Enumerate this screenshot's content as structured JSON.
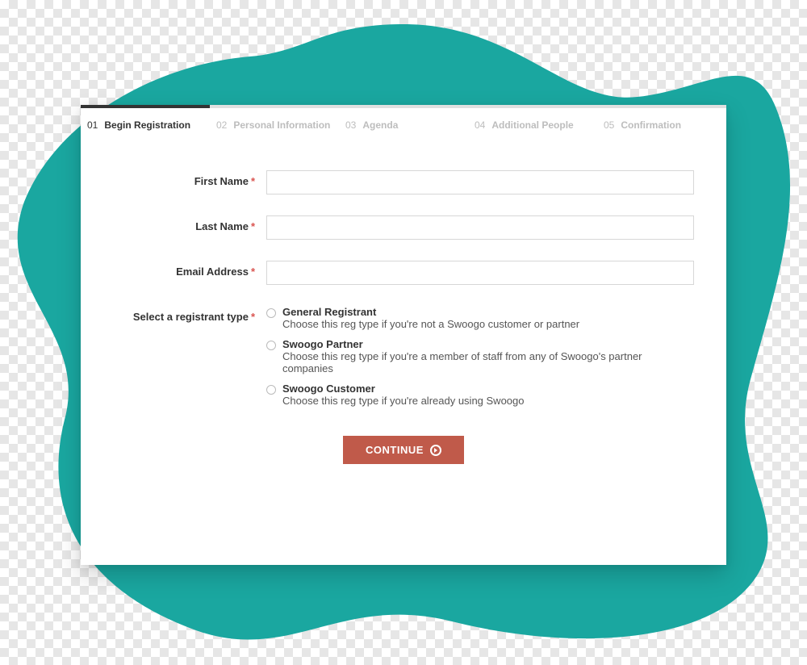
{
  "steps": [
    {
      "num": "01",
      "label": "Begin Registration",
      "active": true
    },
    {
      "num": "02",
      "label": "Personal Information",
      "active": false
    },
    {
      "num": "03",
      "label": "Agenda",
      "active": false
    },
    {
      "num": "04",
      "label": "Additional People",
      "active": false
    },
    {
      "num": "05",
      "label": "Confirmation",
      "active": false
    }
  ],
  "fields": {
    "first_name": {
      "label": "First Name",
      "required": true,
      "value": ""
    },
    "last_name": {
      "label": "Last Name",
      "required": true,
      "value": ""
    },
    "email": {
      "label": "Email Address",
      "required": true,
      "value": ""
    }
  },
  "registrant_type": {
    "label": "Select a registrant type",
    "required": true,
    "options": [
      {
        "title": "General Registrant",
        "desc": "Choose this reg type if you're not a Swoogo customer or partner"
      },
      {
        "title": "Swoogo Partner",
        "desc": "Choose this reg type if you're a member of staff from any of Swoogo's partner companies"
      },
      {
        "title": "Swoogo Customer",
        "desc": "Choose this reg type if you're already using Swoogo"
      }
    ]
  },
  "buttons": {
    "continue": "CONTINUE"
  },
  "asterisk": "*",
  "colors": {
    "accent": "#1aa7a0",
    "button": "#c05a4a"
  }
}
